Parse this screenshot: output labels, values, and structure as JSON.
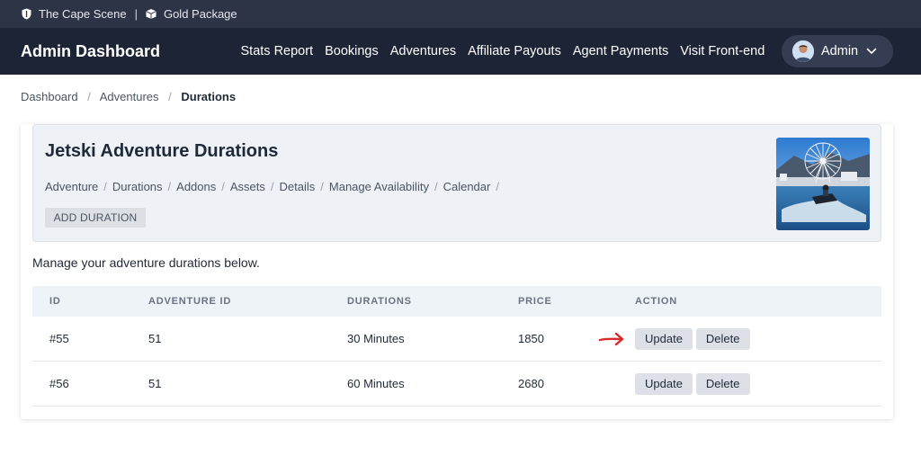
{
  "topbar": {
    "site_name": "The Cape Scene",
    "separator": "|",
    "package": "Gold Package",
    "shield_icon": "shield-icon",
    "box_icon": "box-icon"
  },
  "nav": {
    "brand": "Admin Dashboard",
    "items": [
      {
        "label": "Stats Report"
      },
      {
        "label": "Bookings"
      },
      {
        "label": "Adventures"
      },
      {
        "label": "Affiliate Payouts"
      },
      {
        "label": "Agent Payments"
      },
      {
        "label": "Visit Front-end"
      }
    ],
    "user_label": "Admin",
    "user_icon": "chevron-down-icon"
  },
  "breadcrumb": {
    "items": [
      "Dashboard",
      "Adventures",
      "Durations"
    ],
    "separator": "/"
  },
  "hero": {
    "title": "Jetski Adventure Durations",
    "links": [
      "Adventure",
      "Durations",
      "Addons",
      "Assets",
      "Details",
      "Manage Availability",
      "Calendar"
    ],
    "separator": "/",
    "add_button": "ADD DURATION",
    "thumbnail": "ferris-wheel-jetski-photo"
  },
  "manage_text": "Manage your adventure durations below.",
  "table": {
    "headers": [
      "ID",
      "ADVENTURE ID",
      "DURATIONS",
      "PRICE",
      "ACTION"
    ],
    "rows": [
      {
        "id": "#55",
        "adventure_id": "51",
        "duration": "30 Minutes",
        "price": "1850",
        "update": "Update",
        "delete": "Delete"
      },
      {
        "id": "#56",
        "adventure_id": "51",
        "duration": "60 Minutes",
        "price": "2680",
        "update": "Update",
        "delete": "Delete"
      }
    ]
  },
  "colors": {
    "topbar_bg": "#2d3446",
    "nav_bg": "#1d2435",
    "hero_bg": "#eef1f6",
    "arrow": "#d92b2b"
  }
}
